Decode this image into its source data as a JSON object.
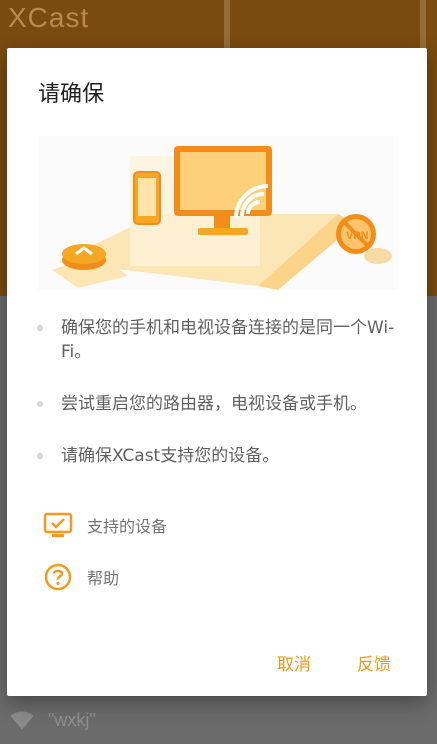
{
  "background": {
    "app_title": "XCast",
    "wifi_name": "\"wxkj\"",
    "header_color": "#7a4b10"
  },
  "dialog": {
    "title": "请确保",
    "tips": [
      "确保您的手机和电视设备连接的是同一个Wi-Fi。",
      "尝试重启您的路由器，电视设备或手机。",
      "请确保XCast支持您的设备。"
    ],
    "links": [
      {
        "label": "支持的设备",
        "icon": "tv-check-icon"
      },
      {
        "label": "帮助",
        "icon": "help-circle-icon"
      }
    ],
    "illustration": {
      "badge_text": "VPN"
    },
    "buttons": {
      "cancel": "取消",
      "feedback": "反馈"
    }
  },
  "colors": {
    "accent": "#f39a1e",
    "accent_dark": "#f28c1a"
  }
}
